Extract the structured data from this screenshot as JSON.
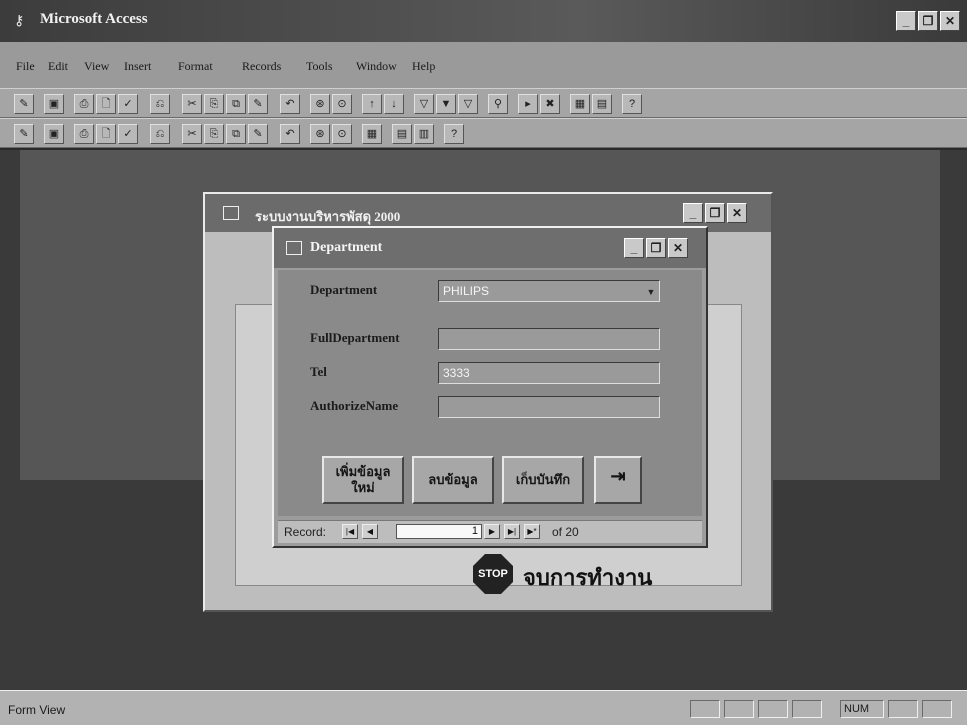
{
  "app": {
    "title": "Microsoft Access"
  },
  "window_controls": {
    "minimize": "_",
    "restore": "❐",
    "close": "✕"
  },
  "menu": [
    "File",
    "Edit",
    "View",
    "Insert",
    "Format",
    "Records",
    "Tools",
    "Window",
    "Help"
  ],
  "toolbar1": [
    "✎",
    "▣",
    "⎙",
    "🗋",
    "✓",
    "⎌",
    "✂",
    "⎘",
    "⧉",
    "✎",
    "↶",
    "⊛",
    "⊙",
    "↑",
    "↓",
    "▽",
    "▼",
    "▽",
    "⚲",
    "▸",
    "✖",
    "▦",
    "▤",
    "?"
  ],
  "toolbar2": [
    "✎",
    "▣",
    "⎙",
    "🗋",
    "✓",
    "⎌",
    "✂",
    "⎘",
    "⧉",
    "✎",
    "↶",
    "⊛",
    "⊙",
    "▦",
    "▤",
    "▥",
    "?"
  ],
  "main_form": {
    "title": "ระบบงานบริหารพัสดุ 2000",
    "stop_icon_label": "STOP",
    "stop_text": "จบการทำงาน"
  },
  "dept_form": {
    "title": "Department",
    "fields": {
      "department": {
        "label": "Department",
        "value": "PHILIPS"
      },
      "full_department": {
        "label": "FullDepartment",
        "value": ""
      },
      "tel": {
        "label": "Tel",
        "value": "3333"
      },
      "authorize_name": {
        "label": "AuthorizeName",
        "value": ""
      }
    },
    "buttons": {
      "add_new_line1": "เพิ่มข้อมูล",
      "add_new_line2": "ใหม่",
      "delete": "ลบข้อมูล",
      "save": "เก็บบันทึก",
      "exit_icon": "⇥"
    },
    "navigator": {
      "label": "Record:",
      "current": "1",
      "total_text": "of 20",
      "first": "|◀",
      "prev": "◀",
      "next": "▶",
      "last": "▶|",
      "new": "▶*"
    }
  },
  "status": {
    "text": "Form View",
    "num": "NUM"
  }
}
